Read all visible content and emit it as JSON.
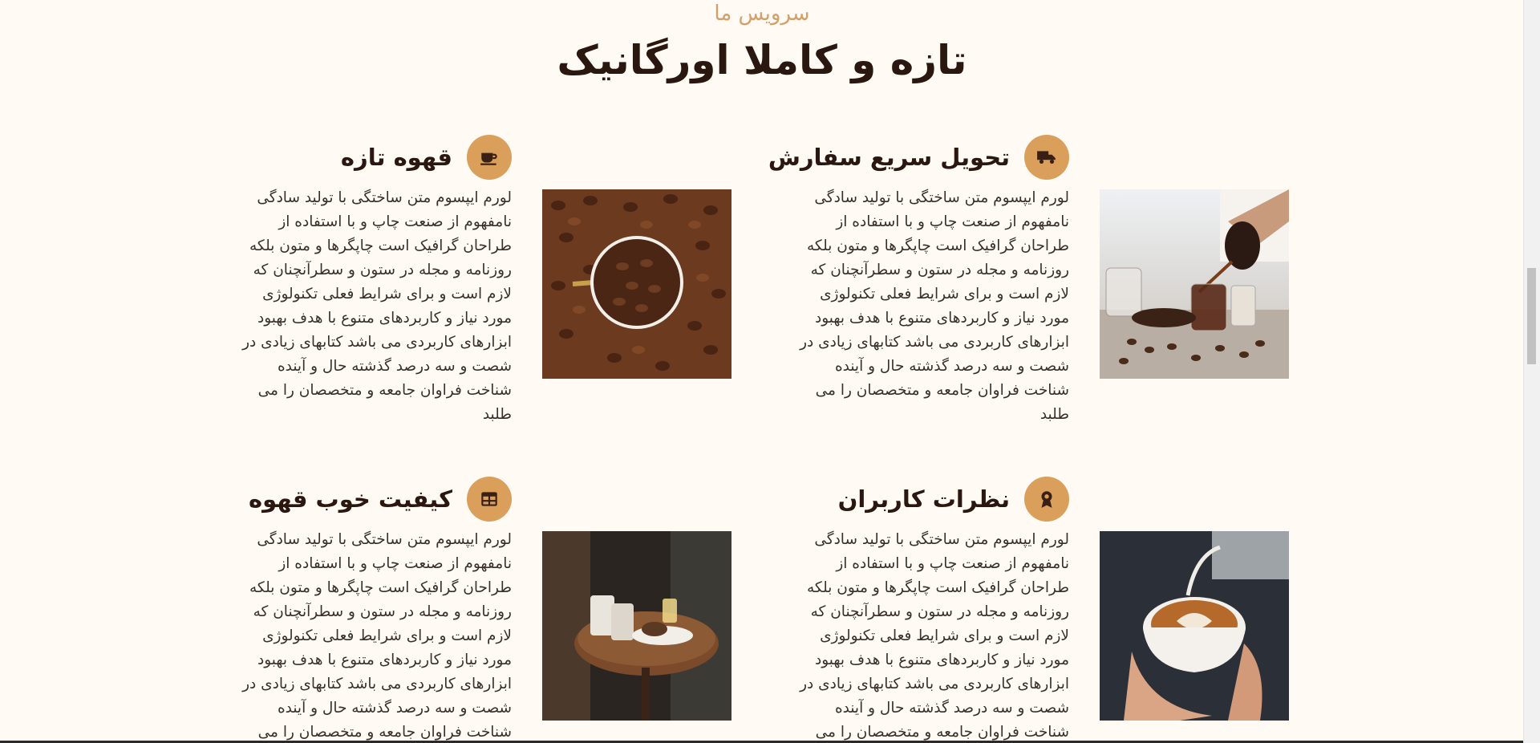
{
  "section": {
    "kicker": "سرویس ما",
    "title": "تازه و کاملا اورگانیک"
  },
  "services": [
    {
      "title": "تحویل سریع سفارش",
      "icon": "truck-icon",
      "image": "coffee-pour-photo",
      "text": "لورم ایپسوم متن ساختگی با تولید سادگی نامفهوم از صنعت چاپ و با استفاده از طراحان گرافیک است چاپگرها و متون بلکه روزنامه و مجله در ستون و سطرآنچنان که لازم است و برای شرایط فعلی تکنولوژی مورد نیاز و کاربردهای متنوع با هدف بهبود ابزارهای کاربردی می باشد کتابهای زیادی در شصت و سه درصد گذشته حال و آینده شناخت فراوان جامعه و متخصصان را می طلبد"
    },
    {
      "title": "قهوه تازه",
      "icon": "coffee-cup-icon",
      "image": "coffee-beans-photo",
      "text": "لورم ایپسوم متن ساختگی با تولید سادگی نامفهوم از صنعت چاپ و با استفاده از طراحان گرافیک است چاپگرها و متون بلکه روزنامه و مجله در ستون و سطرآنچنان که لازم است و برای شرایط فعلی تکنولوژی مورد نیاز و کاربردهای متنوع با هدف بهبود ابزارهای کاربردی می باشد کتابهای زیادی در شصت و سه درصد گذشته حال و آینده شناخت فراوان جامعه و متخصصان را می طلبد"
    },
    {
      "title": "نظرات کاربران",
      "icon": "award-icon",
      "image": "latte-art-photo",
      "text": "لورم ایپسوم متن ساختگی با تولید سادگی نامفهوم از صنعت چاپ و با استفاده از طراحان گرافیک است چاپگرها و متون بلکه روزنامه و مجله در ستون و سطرآنچنان که لازم است و برای شرایط فعلی تکنولوژی مورد نیاز و کاربردهای متنوع با هدف بهبود ابزارهای کاربردی می باشد کتابهای زیادی در شصت و سه درصد گذشته حال و آینده شناخت فراوان جامعه و متخصصان را می طلبد"
    },
    {
      "title": "کیفیت خوب قهوه",
      "icon": "table-icon",
      "image": "cafe-table-photo",
      "text": "لورم ایپسوم متن ساختگی با تولید سادگی نامفهوم از صنعت چاپ و با استفاده از طراحان گرافیک است چاپگرها و متون بلکه روزنامه و مجله در ستون و سطرآنچنان که لازم است و برای شرایط فعلی تکنولوژی مورد نیاز و کاربردهای متنوع با هدف بهبود ابزارهای کاربردی می باشد کتابهای زیادی در شصت و سه درصد گذشته حال و آینده شناخت فراوان جامعه و متخصصان را می طلبد"
    }
  ],
  "colors": {
    "accent": "#d99f5b",
    "background": "#fffaf4",
    "heading": "#2a1710"
  }
}
